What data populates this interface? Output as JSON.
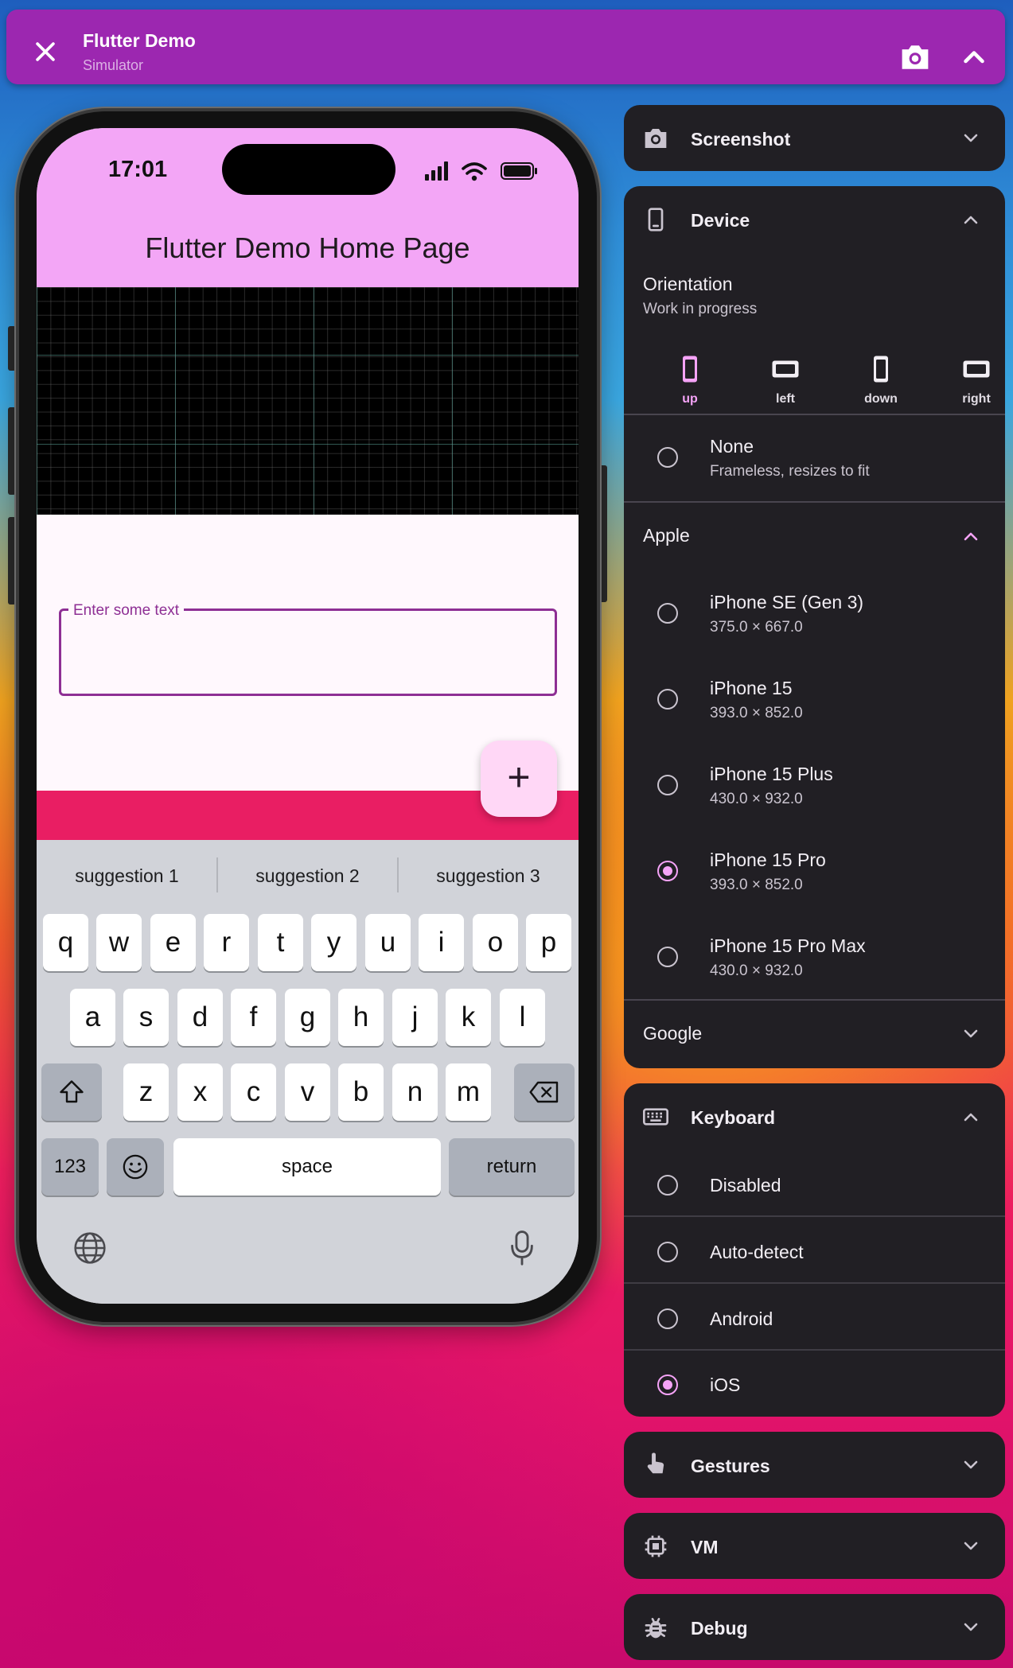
{
  "topbar": {
    "title": "Flutter Demo",
    "subtitle": "Simulator",
    "close_icon": "close-icon",
    "screenshot_icon": "camera-icon",
    "collapse_icon": "chevron-up-icon"
  },
  "phone": {
    "status_time": "17:01",
    "app_title": "Flutter Demo Home Page",
    "text_field_label": "Enter some text",
    "text_field_value": "",
    "fab_label": "+",
    "suggestions": [
      "suggestion 1",
      "suggestion 2",
      "suggestion 3"
    ],
    "keys_row1": [
      "q",
      "w",
      "e",
      "r",
      "t",
      "y",
      "u",
      "i",
      "o",
      "p"
    ],
    "keys_row2": [
      "a",
      "s",
      "d",
      "f",
      "g",
      "h",
      "j",
      "k",
      "l"
    ],
    "keys_row3": [
      "z",
      "x",
      "c",
      "v",
      "b",
      "n",
      "m"
    ],
    "key_123": "123",
    "key_space": "space",
    "key_return": "return",
    "colors": {
      "appbar": "#f3a6f6",
      "accent": "#8e2f94",
      "strip": "#e91e63"
    }
  },
  "panels": {
    "screenshot": {
      "title": "Screenshot"
    },
    "device": {
      "title": "Device",
      "orientation_title": "Orientation",
      "orientation_sub": "Work in progress",
      "orientations": [
        {
          "label": "up",
          "selected": true
        },
        {
          "label": "left",
          "selected": false
        },
        {
          "label": "down",
          "selected": false
        },
        {
          "label": "right",
          "selected": false
        }
      ],
      "none": {
        "title": "None",
        "sub": "Frameless, resizes to fit"
      },
      "apple_group": "Apple",
      "apple_devices": [
        {
          "name": "iPhone SE (Gen 3)",
          "size": "375.0 × 667.0",
          "selected": false
        },
        {
          "name": "iPhone 15",
          "size": "393.0 × 852.0",
          "selected": false
        },
        {
          "name": "iPhone 15 Plus",
          "size": "430.0 × 932.0",
          "selected": false
        },
        {
          "name": "iPhone 15 Pro",
          "size": "393.0 × 852.0",
          "selected": true
        },
        {
          "name": "iPhone 15 Pro Max",
          "size": "430.0 × 932.0",
          "selected": false
        }
      ],
      "google_group": "Google"
    },
    "keyboard": {
      "title": "Keyboard",
      "options": [
        {
          "label": "Disabled",
          "selected": false
        },
        {
          "label": "Auto-detect",
          "selected": false
        },
        {
          "label": "Android",
          "selected": false
        },
        {
          "label": "iOS",
          "selected": true
        }
      ]
    },
    "gestures": {
      "title": "Gestures"
    },
    "vm": {
      "title": "VM"
    },
    "debug": {
      "title": "Debug"
    },
    "accent_color": "#f5a3f7"
  }
}
